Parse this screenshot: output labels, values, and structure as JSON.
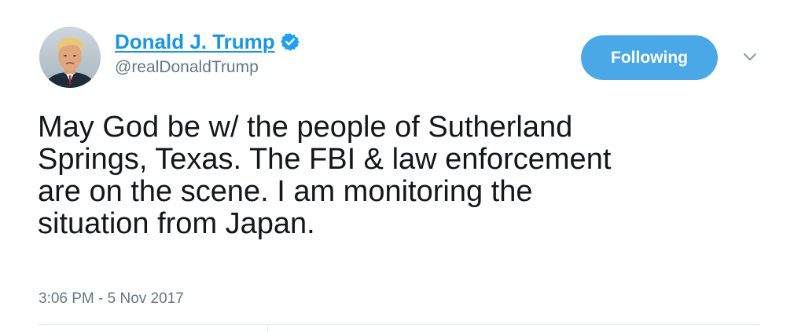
{
  "author": {
    "display_name": "Donald J. Trump",
    "handle": "@realDonaldTrump",
    "verified": true,
    "avatar_icon": "profile-photo"
  },
  "follow_button": {
    "label": "Following"
  },
  "menu": {
    "icon": "chevron-down-icon"
  },
  "tweet": {
    "lines": [
      "May God be w/ the people of Sutherland",
      "Springs, Texas. The FBI & law enforcement",
      "are on the scene. I am monitoring the",
      "situation from Japan."
    ],
    "timestamp": "3:06 PM - 5 Nov 2017"
  },
  "colors": {
    "link_blue": "#1b95e0",
    "button_blue": "#4aa8e7",
    "text_primary": "#14171a",
    "text_secondary": "#657786",
    "divider": "#e6ecf0"
  }
}
